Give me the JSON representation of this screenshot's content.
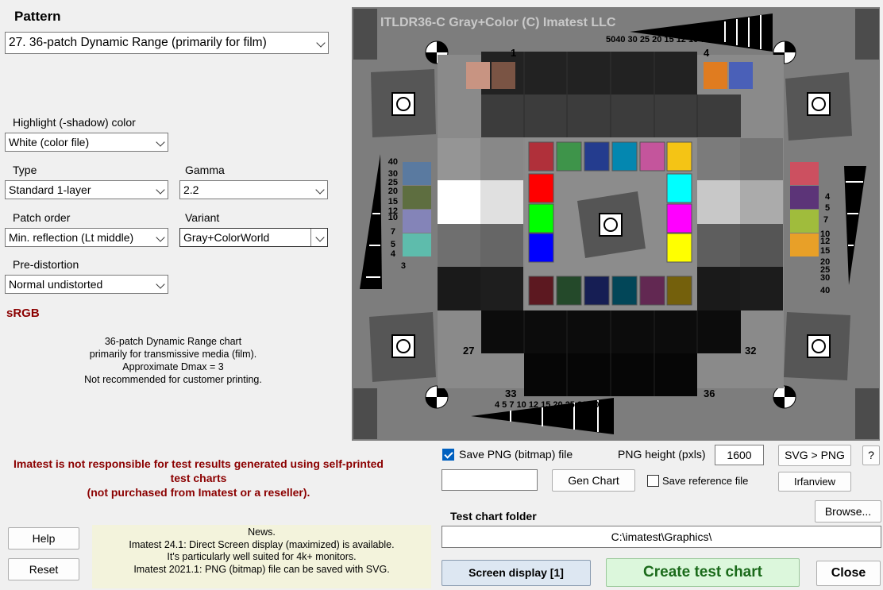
{
  "pattern": {
    "heading": "Pattern",
    "selected": "27. 36-patch Dynamic Range  (primarily for film)"
  },
  "highlight": {
    "label": "Highlight (-shadow) color",
    "selected": "White  (color file)"
  },
  "type": {
    "label": "Type",
    "selected": "Standard 1-layer"
  },
  "gamma": {
    "label": "Gamma",
    "selected": "2.2"
  },
  "patch_order": {
    "label": "Patch order",
    "selected": "Min. reflection (Lt middle)"
  },
  "variant": {
    "label": "Variant",
    "selected": "Gray+ColorWorld"
  },
  "predistortion": {
    "label": "Pre-distortion",
    "selected": "Normal undistorted"
  },
  "colorspace": "sRGB",
  "description": [
    "36-patch Dynamic Range chart",
    "primarily for transmissive media (film).",
    "Approximate Dmax = 3",
    "Not recommended for customer printing."
  ],
  "warning": [
    "Imatest is not responsible for test results generated using self-printed",
    "test charts",
    "(not purchased from Imatest or a reseller)."
  ],
  "news": [
    "News.",
    "Imatest 24.1: Direct Screen display (maximized) is available.",
    "It's particularly well suited for 4k+ monitors.",
    "Imatest 2021.1: PNG (bitmap) file can be saved with SVG."
  ],
  "buttons": {
    "help": "Help",
    "reset": "Reset",
    "gen_chart": "Gen Chart",
    "svg_png": "SVG > PNG",
    "question": "?",
    "irfanview": "Irfanview",
    "browse": "Browse...",
    "screen_display": "Screen display [1]",
    "create": "Create test chart",
    "close": "Close"
  },
  "save_png": {
    "label": "Save PNG (bitmap) file",
    "checked": true
  },
  "save_reference": {
    "label": "Save reference file",
    "checked": false
  },
  "png_height": {
    "label": "PNG height (pxls)",
    "value": "1600"
  },
  "gen_chart_input": "",
  "folder": {
    "label": "Test chart folder",
    "path": "C:\\imatest\\Graphics\\"
  },
  "chart": {
    "title": "ITLDR36-C Gray+Color   (C) Imatest LLC",
    "corner_numbers": [
      "1",
      "4",
      "27",
      "32",
      "33",
      "36"
    ],
    "top_scale": "5040 30 25 20 15 12 10  7   5  4",
    "bottom_scale": "4 5    7    10 12 15 20 25 30 40 50",
    "left_scale": [
      "40",
      "30",
      "25",
      "20",
      "15",
      "12",
      "10",
      "7",
      "5",
      "4",
      "3"
    ],
    "right_scale": [
      "4",
      "5",
      "7",
      "10",
      "12",
      "15",
      "20",
      "25",
      "30",
      "40"
    ],
    "accent_colors": [
      "#2b62c4",
      "#8b0000",
      "#1a8a1a"
    ]
  }
}
